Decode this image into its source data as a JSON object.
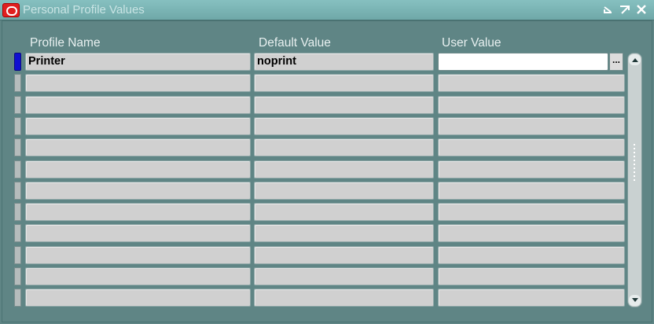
{
  "window": {
    "title": "Personal Profile Values",
    "controls": [
      "minimize-icon",
      "maximize-icon",
      "close-icon"
    ]
  },
  "columns": {
    "profile_name": "Profile Name",
    "default_value": "Default Value",
    "user_value": "User Value"
  },
  "rows": [
    {
      "profile_name": "Printer",
      "default_value": "noprint",
      "user_value": ""
    },
    {
      "profile_name": "",
      "default_value": "",
      "user_value": ""
    },
    {
      "profile_name": "",
      "default_value": "",
      "user_value": ""
    },
    {
      "profile_name": "",
      "default_value": "",
      "user_value": ""
    },
    {
      "profile_name": "",
      "default_value": "",
      "user_value": ""
    },
    {
      "profile_name": "",
      "default_value": "",
      "user_value": ""
    },
    {
      "profile_name": "",
      "default_value": "",
      "user_value": ""
    },
    {
      "profile_name": "",
      "default_value": "",
      "user_value": ""
    },
    {
      "profile_name": "",
      "default_value": "",
      "user_value": ""
    },
    {
      "profile_name": "",
      "default_value": "",
      "user_value": ""
    },
    {
      "profile_name": "",
      "default_value": "",
      "user_value": ""
    },
    {
      "profile_name": "",
      "default_value": "",
      "user_value": ""
    }
  ],
  "lov_button_label": "...",
  "colors": {
    "background": "#5f8585",
    "titlebar": "#7db6b6",
    "current_record": "#1010d0",
    "field": "#d0d0d0"
  }
}
